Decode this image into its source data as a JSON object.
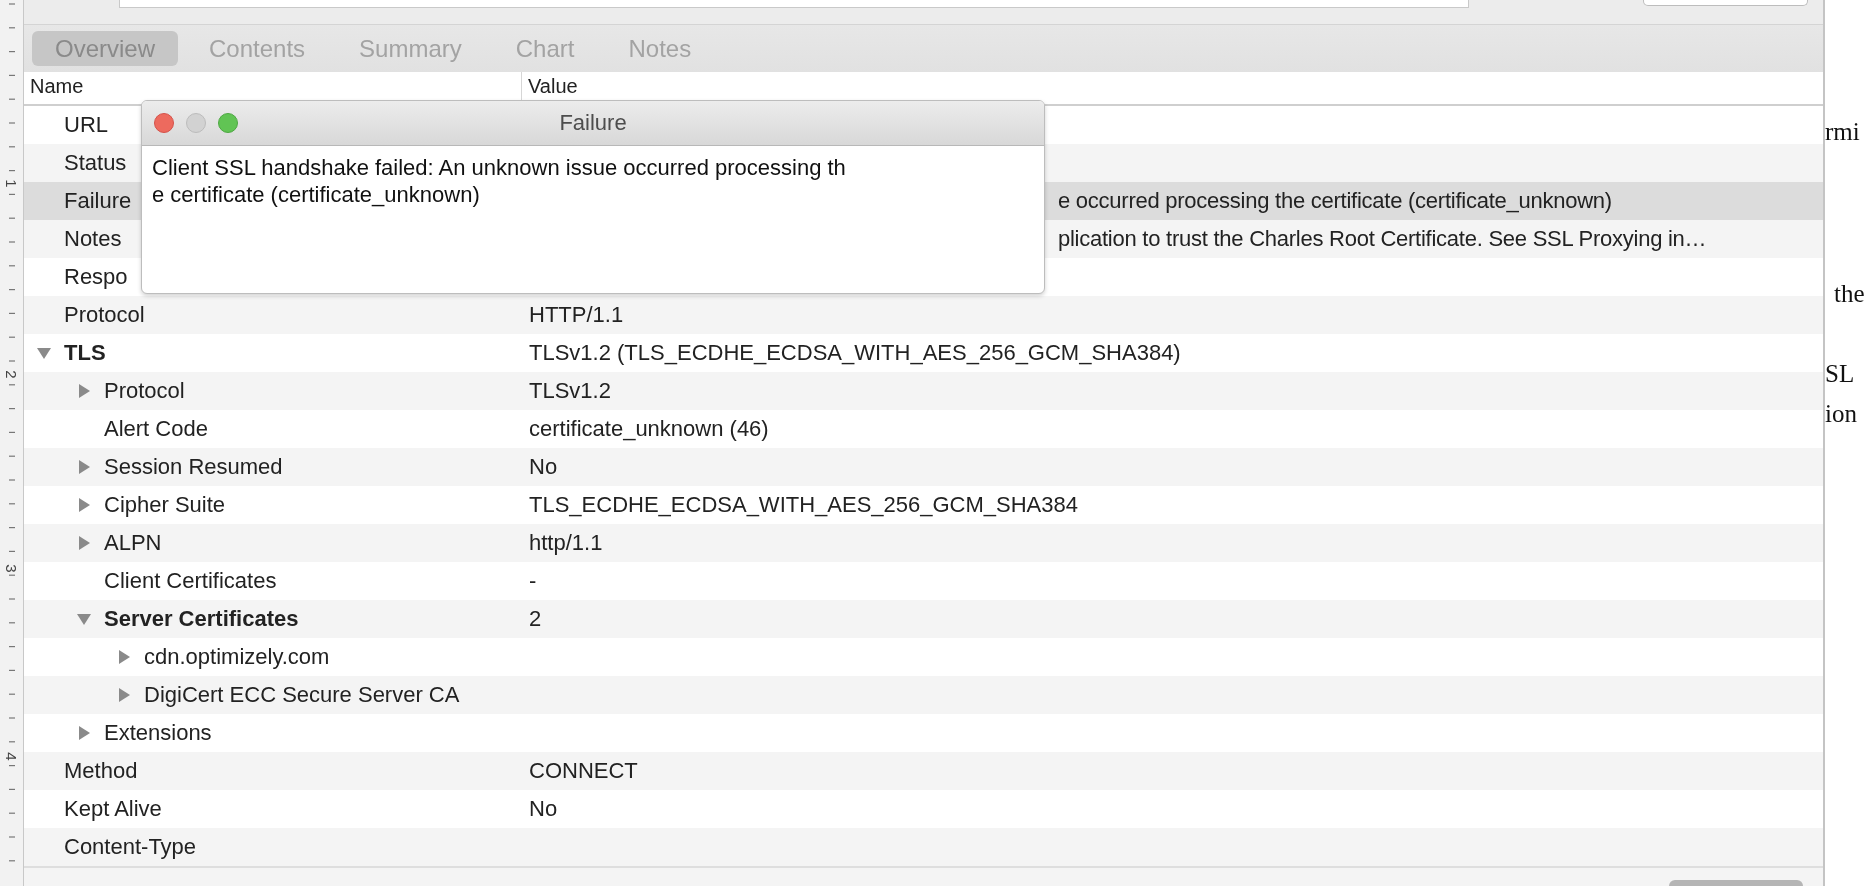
{
  "tabs": [
    {
      "label": "Overview",
      "selected": true
    },
    {
      "label": "Contents",
      "selected": false
    },
    {
      "label": "Summary",
      "selected": false
    },
    {
      "label": "Chart",
      "selected": false
    },
    {
      "label": "Notes",
      "selected": false
    }
  ],
  "table": {
    "columns": [
      "Name",
      "Value"
    ],
    "rows": [
      {
        "name": "URL",
        "selected": false
      },
      {
        "name": "Status",
        "selected": false
      },
      {
        "name": "Failure",
        "value": "e occurred processing the certificate (certificate_unknown)",
        "covered": true,
        "selected": true
      },
      {
        "name": "Notes",
        "value": "plication to trust the Charles Root Certificate. See SSL Proxying in…",
        "covered": true,
        "selected": false
      },
      {
        "name": "Respo",
        "selected": false
      },
      {
        "name": "Protocol",
        "value": "HTTP/1.1",
        "selected": false
      },
      {
        "name": "TLS",
        "value": "TLSv1.2 (TLS_ECDHE_ECDSA_WITH_AES_256_GCM_SHA384)",
        "expanded": true,
        "selected": false,
        "children": [
          {
            "name": "Protocol",
            "value": "TLSv1.2",
            "expanded": false,
            "selected": false
          },
          {
            "name": "Alert Code",
            "value": "certificate_unknown (46)",
            "selected": false
          },
          {
            "name": "Session Resumed",
            "value": "No",
            "expanded": false,
            "selected": false
          },
          {
            "name": "Cipher Suite",
            "value": "TLS_ECDHE_ECDSA_WITH_AES_256_GCM_SHA384",
            "expanded": false,
            "selected": false
          },
          {
            "name": "ALPN",
            "value": "http/1.1",
            "expanded": false,
            "selected": false
          },
          {
            "name": "Client Certificates",
            "value": "-",
            "selected": false
          },
          {
            "name": "Server Certificates",
            "value": "2",
            "expanded": true,
            "selected": false,
            "children": [
              {
                "name": "cdn.optimizely.com",
                "expanded": false,
                "selected": false
              },
              {
                "name": "DigiCert ECC Secure Server CA",
                "expanded": false,
                "selected": false
              }
            ]
          },
          {
            "name": "Extensions",
            "expanded": false,
            "selected": false
          }
        ]
      },
      {
        "name": "Method",
        "value": "CONNECT",
        "selected": false
      },
      {
        "name": "Kept Alive",
        "value": "No",
        "selected": false
      },
      {
        "name": "Content-Type",
        "selected": false
      }
    ]
  },
  "dialog": {
    "title": "Failure",
    "message_lines": [
      "Client SSL handshake failed: An unknown issue occurred processing th",
      "e certificate (certificate_unknown)"
    ]
  },
  "ruler": {
    "labels": [
      "1",
      "2",
      "3",
      "4"
    ]
  },
  "background_document": {
    "fragments": [
      "rmi",
      "the",
      "SL",
      "ion"
    ]
  }
}
